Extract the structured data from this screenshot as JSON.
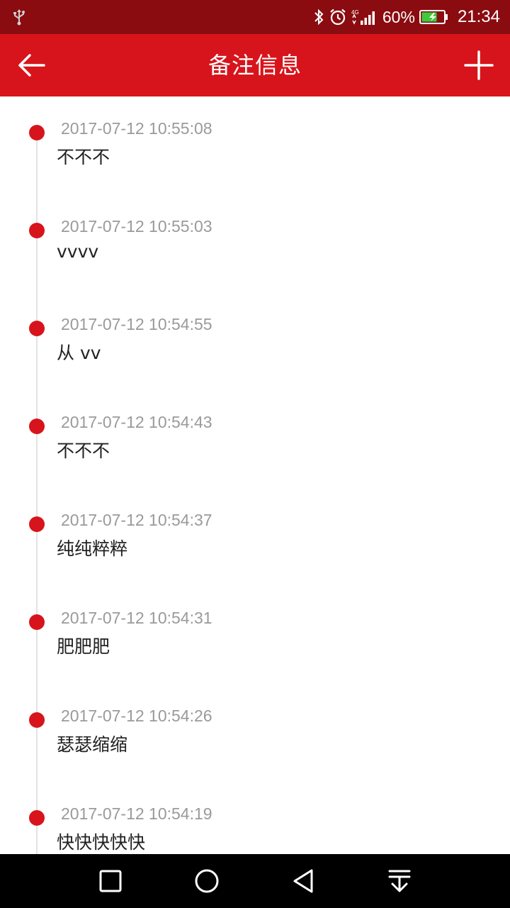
{
  "status_bar": {
    "battery_percent": "60%",
    "time": "21:34",
    "network_label": "4G",
    "icons": [
      "usb-icon",
      "bluetooth-icon",
      "alarm-icon",
      "signal-icon",
      "battery-charging-icon"
    ]
  },
  "header": {
    "title": "备注信息",
    "back_icon": "arrow-left-icon",
    "add_icon": "plus-icon"
  },
  "notes": [
    {
      "time": "2017-07-12 10:55:08",
      "text": "不不不"
    },
    {
      "time": "2017-07-12 10:55:03",
      "text": "vvvv"
    },
    {
      "time": "2017-07-12 10:54:55",
      "text": "从 vv"
    },
    {
      "time": "2017-07-12 10:54:43",
      "text": "不不不"
    },
    {
      "time": "2017-07-12 10:54:37",
      "text": "纯纯粹粹"
    },
    {
      "time": "2017-07-12 10:54:31",
      "text": "肥肥肥"
    },
    {
      "time": "2017-07-12 10:54:26",
      "text": "瑟瑟缩缩"
    },
    {
      "time": "2017-07-12 10:54:19",
      "text": "快快快快快"
    }
  ],
  "nav_bar": {
    "icons": [
      "recents-square-icon",
      "home-circle-icon",
      "back-triangle-icon",
      "notification-pulldown-icon"
    ]
  },
  "colors": {
    "status_bar": "#8a0c10",
    "app_bar": "#d7141b",
    "accent_dot": "#d7141b",
    "timestamp": "#9a9a9a",
    "note_text": "#222222",
    "timeline_line": "#e3e3e3",
    "nav_bar": "#000000"
  }
}
